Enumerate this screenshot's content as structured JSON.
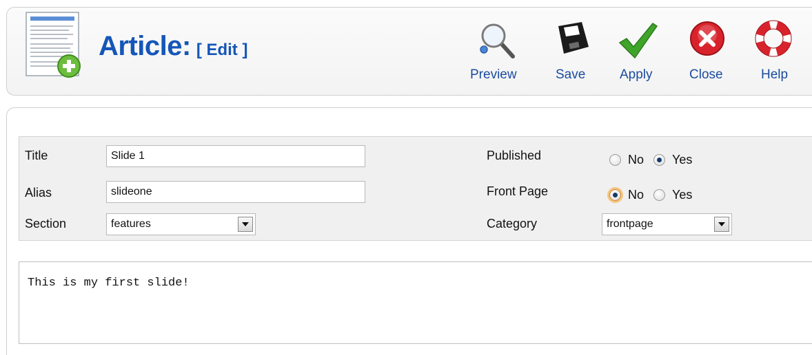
{
  "header": {
    "title": "Article:",
    "subtitle": "[ Edit ]",
    "icon": "article-add-icon"
  },
  "toolbar": {
    "buttons": [
      {
        "label": "Preview",
        "icon": "magnifier-icon"
      },
      {
        "label": "Save",
        "icon": "floppy-disk-icon"
      },
      {
        "label": "Apply",
        "icon": "checkmark-icon"
      },
      {
        "label": "Close",
        "icon": "close-x-icon"
      },
      {
        "label": "Help",
        "icon": "lifebuoy-icon"
      }
    ]
  },
  "form": {
    "title": {
      "label": "Title",
      "value": "Slide 1"
    },
    "alias": {
      "label": "Alias",
      "value": "slideone"
    },
    "section": {
      "label": "Section",
      "value": "features"
    },
    "published": {
      "label": "Published",
      "no": "No",
      "yes": "Yes",
      "selected": "Yes"
    },
    "front_page": {
      "label": "Front Page",
      "no": "No",
      "yes": "Yes",
      "selected": "No"
    },
    "category": {
      "label": "Category",
      "value": "frontpage"
    }
  },
  "editor": {
    "content": "This is my first slide!"
  },
  "colors": {
    "title_blue": "#1556b8",
    "toolbar_label": "#1a4c9e",
    "apply_green": "#3fa52a",
    "close_red": "#d9232c"
  }
}
